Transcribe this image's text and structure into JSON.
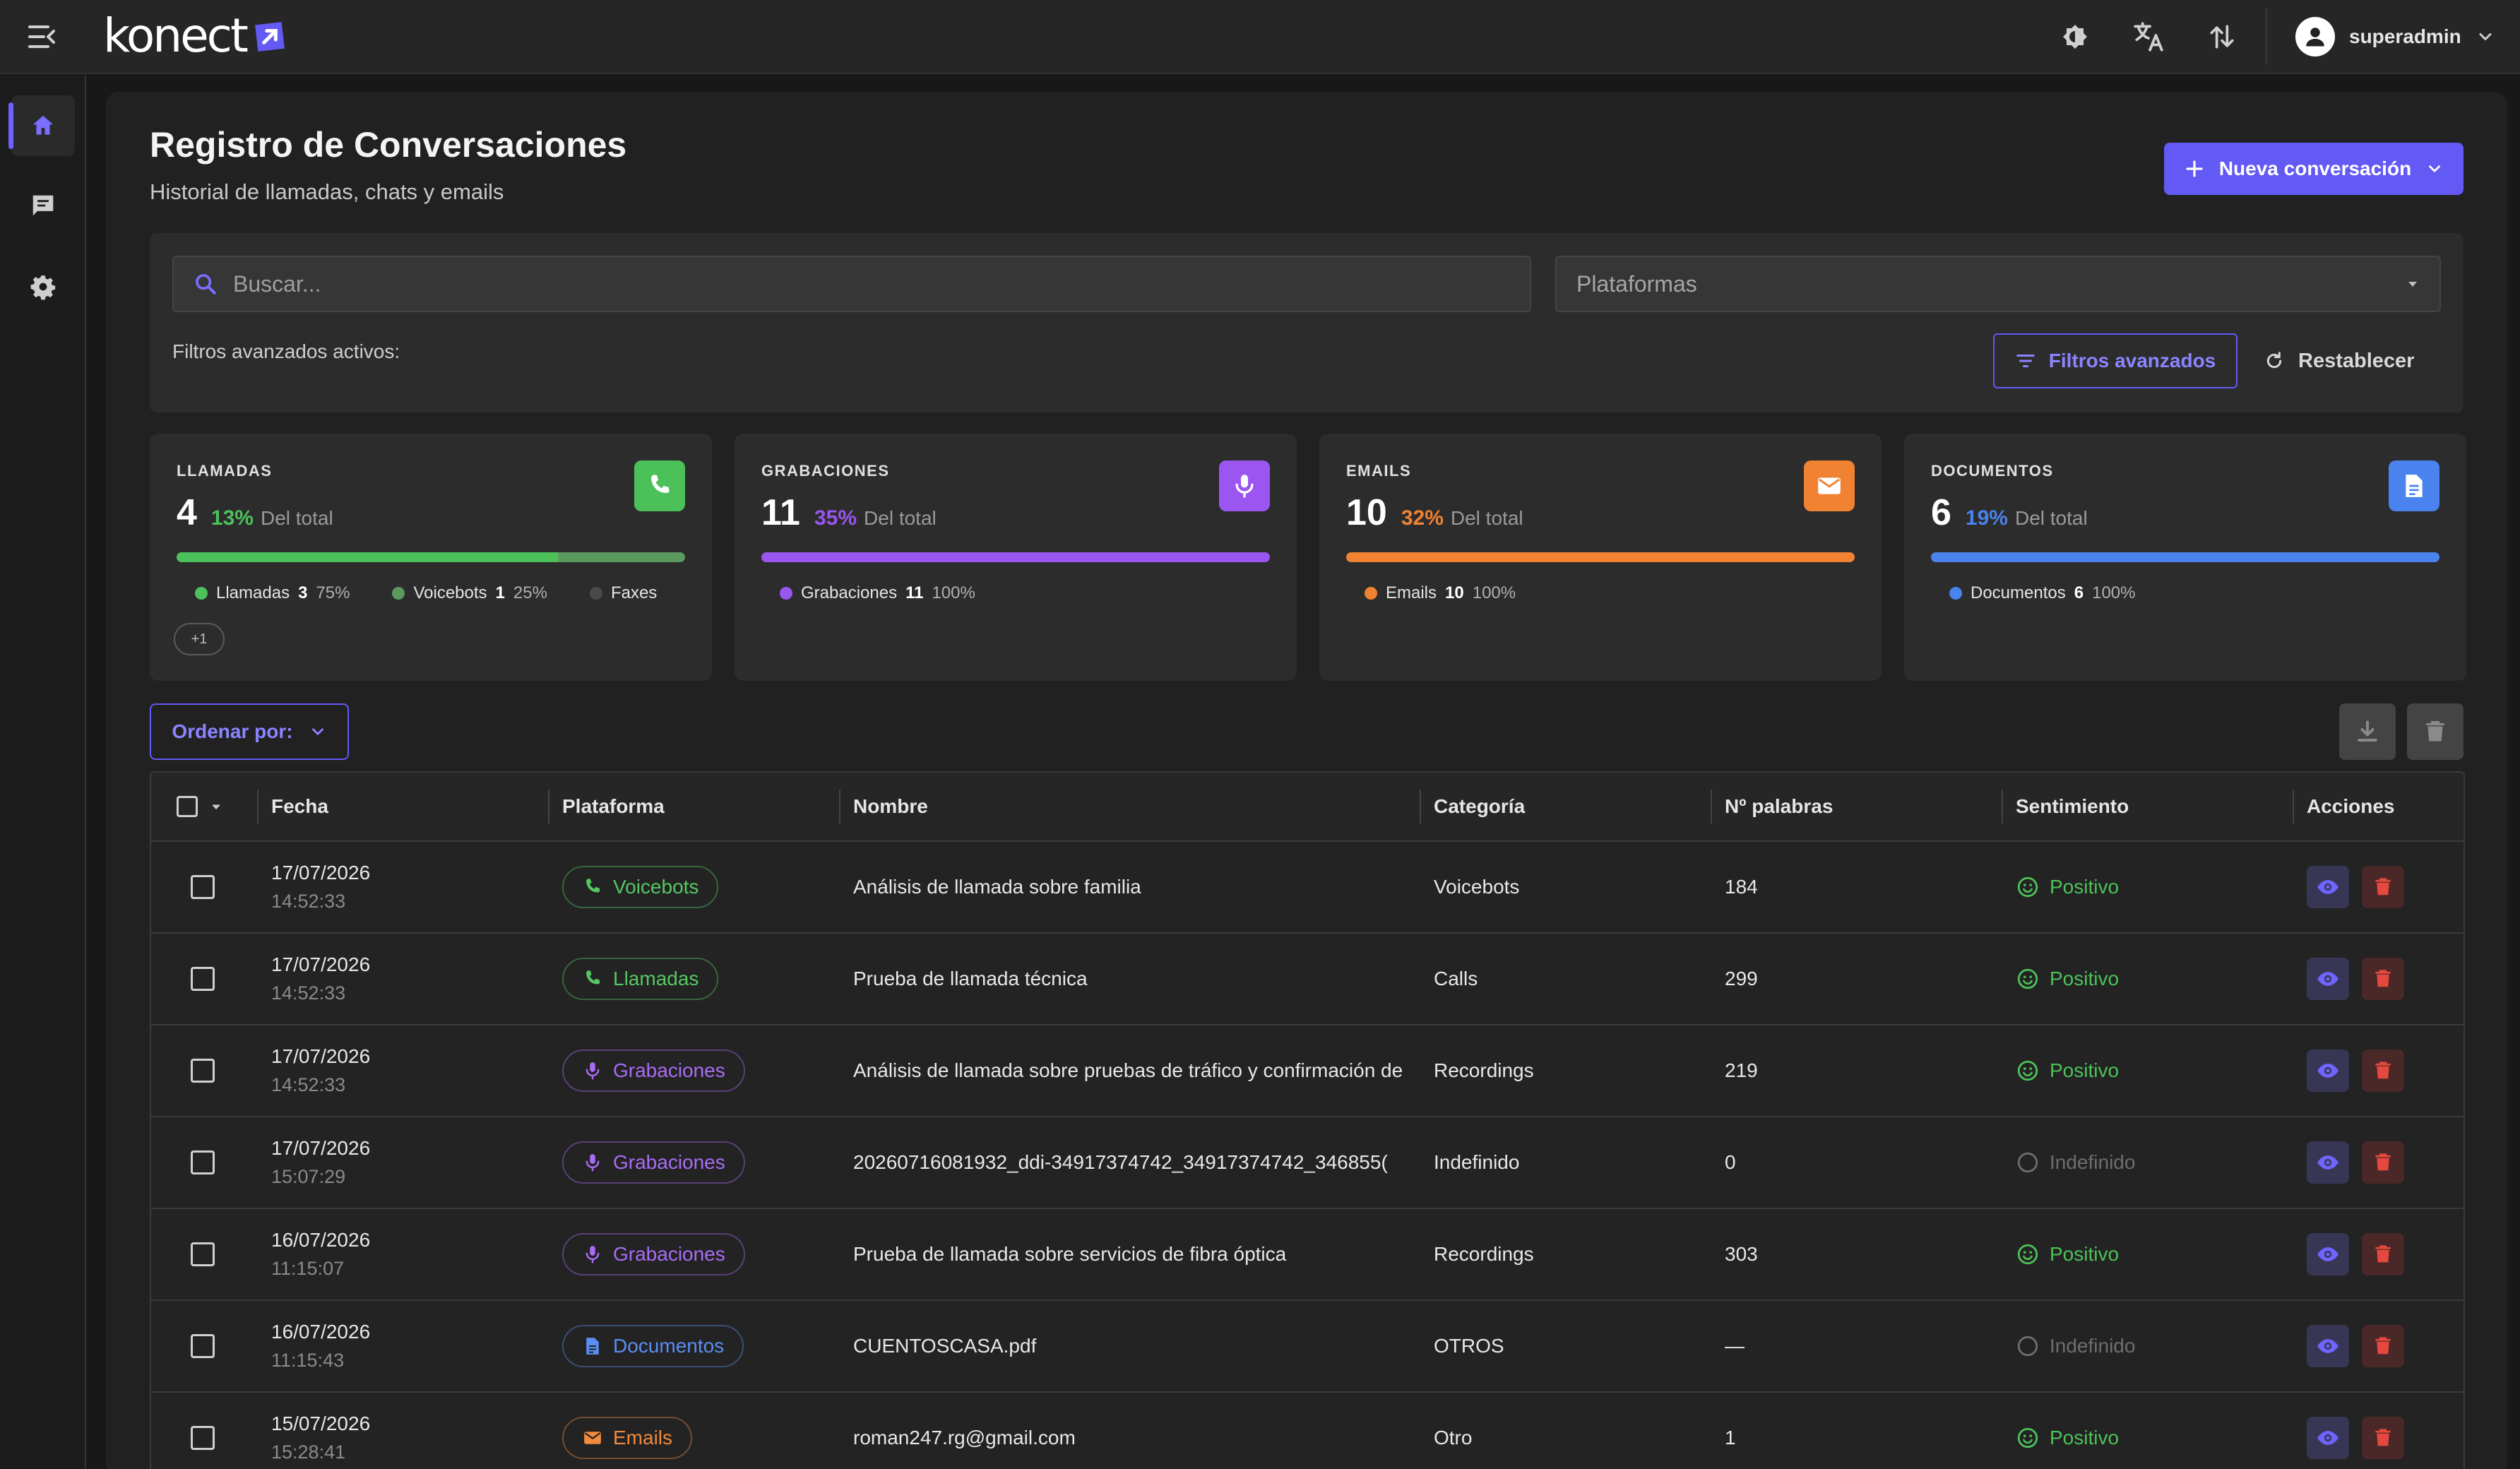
{
  "app": {
    "logo_text": "konect",
    "user_name": "superadmin"
  },
  "header": {
    "title": "Registro de Conversaciones",
    "subtitle": "Historial de llamadas, chats y emails",
    "new_button": "Nueva conversación"
  },
  "filters": {
    "search_placeholder": "Buscar...",
    "platforms_placeholder": "Plataformas",
    "advanced_active_label": "Filtros avanzados activos:",
    "advanced_button": "Filtros avanzados",
    "reset_button": "Restablecer"
  },
  "stats": [
    {
      "label": "LLAMADAS",
      "value": "4",
      "percent": "13%",
      "of_total": "Del total",
      "color": "#4cc15a",
      "icon": "phone-icon",
      "bar": [
        {
          "fraction": 0.75,
          "color": "#4cc15a"
        },
        {
          "fraction": 0.25,
          "color": "#5a9a5e"
        }
      ],
      "legend": [
        {
          "name": "Llamadas",
          "count": "3",
          "percent": "75%",
          "color": "#4cc15a"
        },
        {
          "name": "Voicebots",
          "count": "1",
          "percent": "25%",
          "color": "#5a9a5e"
        },
        {
          "name": "Faxes",
          "count": "",
          "percent": "",
          "color": "#4a4a4a"
        }
      ],
      "more": "+1"
    },
    {
      "label": "GRABACIONES",
      "value": "11",
      "percent": "35%",
      "of_total": "Del total",
      "color": "#9b55f0",
      "icon": "mic-icon",
      "bar": [
        {
          "fraction": 1,
          "color": "#9b55f0"
        }
      ],
      "legend": [
        {
          "name": "Grabaciones",
          "count": "11",
          "percent": "100%",
          "color": "#9b55f0"
        }
      ]
    },
    {
      "label": "EMAILS",
      "value": "10",
      "percent": "32%",
      "of_total": "Del total",
      "color": "#f08232",
      "icon": "mail-icon",
      "bar": [
        {
          "fraction": 1,
          "color": "#f08232"
        }
      ],
      "legend": [
        {
          "name": "Emails",
          "count": "10",
          "percent": "100%",
          "color": "#f08232"
        }
      ]
    },
    {
      "label": "DOCUMENTOS",
      "value": "6",
      "percent": "19%",
      "of_total": "Del total",
      "color": "#4a82ee",
      "icon": "document-icon",
      "bar": [
        {
          "fraction": 1,
          "color": "#4a82ee"
        }
      ],
      "legend": [
        {
          "name": "Documentos",
          "count": "6",
          "percent": "100%",
          "color": "#4a82ee"
        }
      ]
    }
  ],
  "sort_button": "Ordenar por:",
  "table": {
    "columns": [
      "Fecha",
      "Plataforma",
      "Nombre",
      "Categoría",
      "Nº palabras",
      "Sentimiento",
      "Acciones"
    ],
    "rows": [
      {
        "date": "17/07/2026",
        "time": "14:52:33",
        "platform": "Voicebots",
        "platform_icon": "phone-icon",
        "platform_color": "#55c862",
        "name": "Análisis de llamada sobre familia",
        "category": "Voicebots",
        "words": "184",
        "sentiment": "Positivo",
        "sentiment_positive": true
      },
      {
        "date": "17/07/2026",
        "time": "14:52:33",
        "platform": "Llamadas",
        "platform_icon": "phone-icon",
        "platform_color": "#55c862",
        "name": "Prueba de llamada técnica",
        "category": "Calls",
        "words": "299",
        "sentiment": "Positivo",
        "sentiment_positive": true
      },
      {
        "date": "17/07/2026",
        "time": "14:52:33",
        "platform": "Grabaciones",
        "platform_icon": "mic-icon",
        "platform_color": "#a86cf5",
        "name": "Análisis de llamada sobre pruebas de tráfico y confirmación de",
        "category": "Recordings",
        "words": "219",
        "sentiment": "Positivo",
        "sentiment_positive": true
      },
      {
        "date": "17/07/2026",
        "time": "15:07:29",
        "platform": "Grabaciones",
        "platform_icon": "mic-icon",
        "platform_color": "#a86cf5",
        "name": "20260716081932_ddi-34917374742_34917374742_346855(",
        "category": "Indefinido",
        "words": "0",
        "sentiment": "Indefinido",
        "sentiment_positive": false
      },
      {
        "date": "16/07/2026",
        "time": "11:15:07",
        "platform": "Grabaciones",
        "platform_icon": "mic-icon",
        "platform_color": "#a86cf5",
        "name": "Prueba de llamada sobre servicios de fibra óptica",
        "category": "Recordings",
        "words": "303",
        "sentiment": "Positivo",
        "sentiment_positive": true
      },
      {
        "date": "16/07/2026",
        "time": "11:15:43",
        "platform": "Documentos",
        "platform_icon": "document-icon",
        "platform_color": "#5a8ef2",
        "name": "CUENTOSCASA.pdf",
        "category": "OTROS",
        "words": "—",
        "sentiment": "Indefinido",
        "sentiment_positive": false
      },
      {
        "date": "15/07/2026",
        "time": "15:28:41",
        "platform": "Emails",
        "platform_icon": "mail-icon",
        "platform_color": "#f08a3c",
        "name": "roman247.rg@gmail.com",
        "category": "Otro",
        "words": "1",
        "sentiment": "Positivo",
        "sentiment_positive": true
      }
    ]
  },
  "colors": {
    "accent": "#6359f5",
    "positive": "#4cc15a",
    "neutral": "#6e6e6e"
  }
}
